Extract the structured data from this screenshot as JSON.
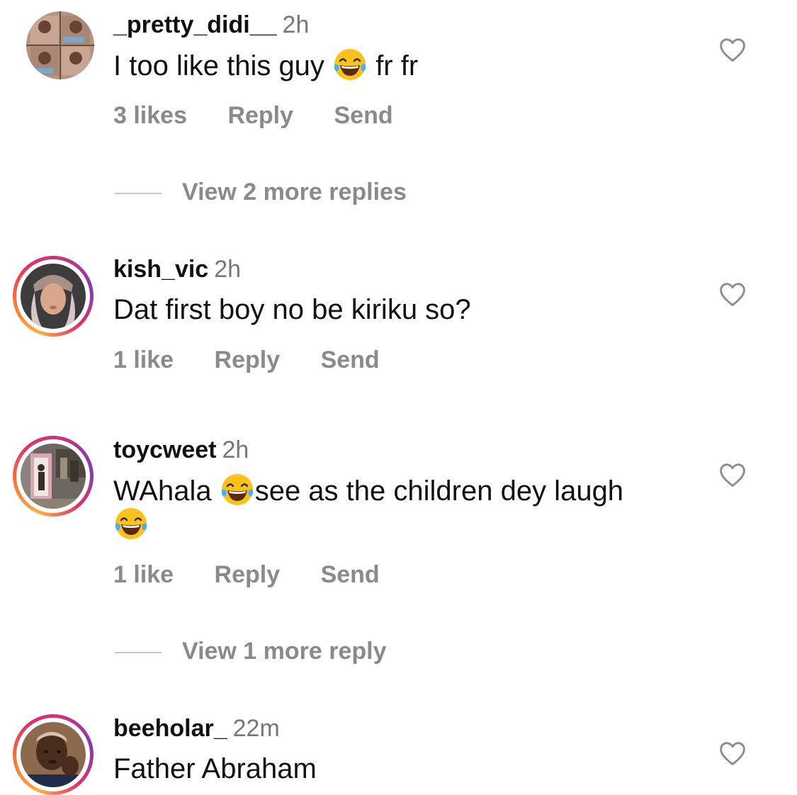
{
  "comments": [
    {
      "username": "_pretty_didi__",
      "time": "2h",
      "text_before": "I too like this guy",
      "emoji": "face-with-tears-of-joy",
      "text_after": "fr fr",
      "likes": "3 likes",
      "reply": "Reply",
      "send": "Send",
      "view_replies": "View 2 more replies"
    },
    {
      "username": "kish_vic",
      "time": "2h",
      "text": "Dat first boy no be kiriku so?",
      "likes": "1 like",
      "reply": "Reply",
      "send": "Send"
    },
    {
      "username": "toycweet",
      "time": "2h",
      "text_before": "WAhala",
      "emoji": "face-with-tears-of-joy",
      "text_after": "see as the children dey laugh",
      "likes": "1 like",
      "reply": "Reply",
      "send": "Send",
      "view_replies": "View 1 more reply"
    },
    {
      "username": "beeholar_",
      "time": "22m",
      "text": "Father Abraham"
    }
  ],
  "icons": {
    "like": "heart-outline-icon",
    "emoji": "face-with-tears-of-joy"
  },
  "colors": {
    "muted": "#8a8a8a",
    "story_ring_start": "#fcaf45",
    "story_ring_end": "#c13584"
  }
}
